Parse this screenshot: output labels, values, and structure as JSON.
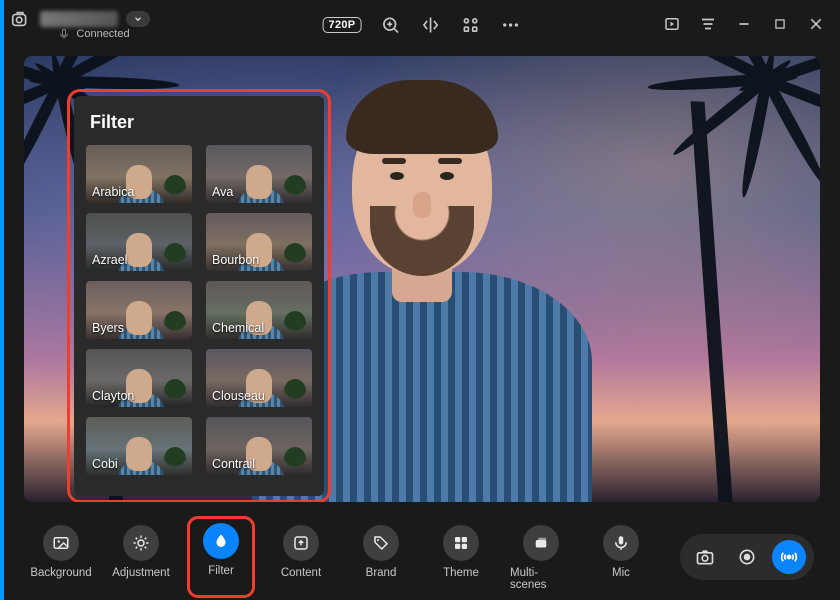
{
  "titlebar": {
    "connected_label": "Connected",
    "resolution_badge": "720P"
  },
  "filter_panel": {
    "title": "Filter",
    "items": [
      {
        "id": "arabica",
        "label": "Arabica"
      },
      {
        "id": "ava",
        "label": "Ava"
      },
      {
        "id": "azrael",
        "label": "Azrael"
      },
      {
        "id": "bourbon",
        "label": "Bourbon"
      },
      {
        "id": "byers",
        "label": "Byers"
      },
      {
        "id": "chemical",
        "label": "Chemical"
      },
      {
        "id": "clayton",
        "label": "Clayton"
      },
      {
        "id": "clouseau",
        "label": "Clouseau"
      },
      {
        "id": "cobi",
        "label": "Cobi"
      },
      {
        "id": "contrail",
        "label": "Contrail"
      }
    ]
  },
  "bottom_tools": [
    {
      "id": "background",
      "label": "Background",
      "icon": "image",
      "active": false,
      "highlighted": false
    },
    {
      "id": "adjustment",
      "label": "Adjustment",
      "icon": "sun",
      "active": false,
      "highlighted": false
    },
    {
      "id": "filter",
      "label": "Filter",
      "icon": "drop",
      "active": true,
      "highlighted": true
    },
    {
      "id": "content",
      "label": "Content",
      "icon": "upload",
      "active": false,
      "highlighted": false
    },
    {
      "id": "brand",
      "label": "Brand",
      "icon": "tag",
      "active": false,
      "highlighted": false
    },
    {
      "id": "theme",
      "label": "Theme",
      "icon": "grid",
      "active": false,
      "highlighted": false
    },
    {
      "id": "multi-scenes",
      "label": "Multi-scenes",
      "icon": "layers",
      "active": false,
      "highlighted": false
    },
    {
      "id": "mic",
      "label": "Mic",
      "icon": "mic",
      "active": false,
      "highlighted": false
    }
  ],
  "colors": {
    "accent": "#0a84ff",
    "callout": "#ef3e2d",
    "bg": "#1a1a1a"
  }
}
